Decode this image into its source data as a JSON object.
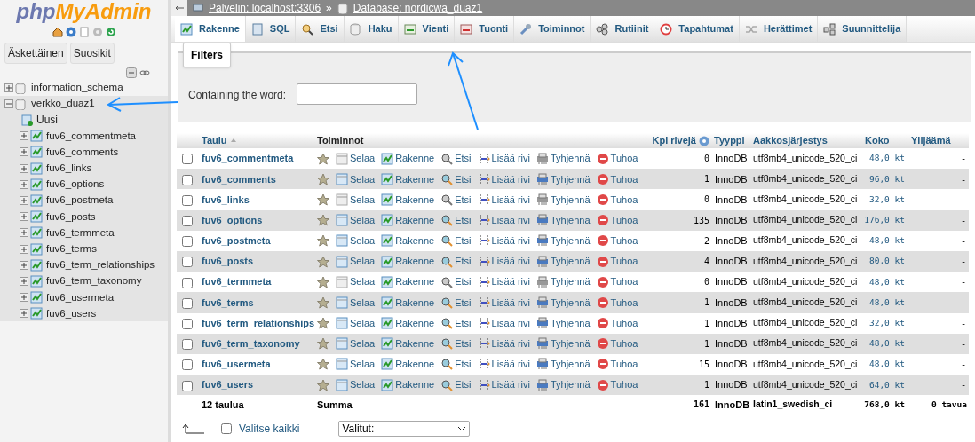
{
  "sidebar": {
    "logo": [
      "php",
      "MyAdmin"
    ],
    "tabs": [
      {
        "label": "Äskettäinen"
      },
      {
        "label": "Suosikit"
      }
    ],
    "tree": [
      {
        "label": "information_schema",
        "expanded": false,
        "selected": false
      },
      {
        "label": "verkko_duaz1",
        "expanded": true,
        "selected": true,
        "children": [
          {
            "label": "Uusi",
            "kind": "new"
          },
          {
            "label": "fuv6_commentmeta",
            "kind": "table"
          },
          {
            "label": "fuv6_comments",
            "kind": "table"
          },
          {
            "label": "fuv6_links",
            "kind": "table"
          },
          {
            "label": "fuv6_options",
            "kind": "table"
          },
          {
            "label": "fuv6_postmeta",
            "kind": "table"
          },
          {
            "label": "fuv6_posts",
            "kind": "table"
          },
          {
            "label": "fuv6_termmeta",
            "kind": "table"
          },
          {
            "label": "fuv6_terms",
            "kind": "table"
          },
          {
            "label": "fuv6_term_relationships",
            "kind": "table"
          },
          {
            "label": "fuv6_term_taxonomy",
            "kind": "table"
          },
          {
            "label": "fuv6_usermeta",
            "kind": "table"
          },
          {
            "label": "fuv6_users",
            "kind": "table"
          }
        ]
      }
    ]
  },
  "breadcrumb": [
    "Palvelin: localhost:3306",
    "»",
    "Database: nordicwa_duaz1"
  ],
  "tabs": [
    {
      "label": "Rakenne",
      "kind": "structure",
      "selected": true
    },
    {
      "label": "SQL",
      "kind": "sql",
      "selected": false
    },
    {
      "label": "Etsi",
      "kind": "search",
      "selected": false
    },
    {
      "label": "Haku",
      "kind": "query",
      "selected": false
    },
    {
      "label": "Vienti",
      "kind": "export",
      "selected": false
    },
    {
      "label": "Tuonti",
      "kind": "import",
      "selected": false
    },
    {
      "label": "Toiminnot",
      "kind": "operations",
      "selected": false
    },
    {
      "label": "Rutiinit",
      "kind": "routines",
      "selected": false
    },
    {
      "label": "Tapahtumat",
      "kind": "events",
      "selected": false
    },
    {
      "label": "Herättimet",
      "kind": "triggers",
      "selected": false
    },
    {
      "label": "Suunnittelija",
      "kind": "designer",
      "selected": false
    }
  ],
  "filters": {
    "legend": "Filters",
    "label": "Containing the word:"
  },
  "table": {
    "columns": [
      "Taulu",
      "Toiminnot",
      "Kpl rivejä",
      "Tyyppi",
      "Aakkosjärjestys",
      "Koko",
      "Ylijäämä"
    ],
    "rows": [
      {
        "name": "fuv6_commentmeta",
        "checked": false,
        "empty": true,
        "actions": [
          "Selaa",
          "Rakenne",
          "Etsi",
          "Lisää rivi",
          "Tyhjennä",
          "Tuhoa"
        ],
        "rows": "0",
        "type": "InnoDB",
        "collation": "utf8mb4_unicode_520_ci",
        "size": "48,0 kt",
        "overhead": "-"
      },
      {
        "name": "fuv6_comments",
        "checked": false,
        "empty": false,
        "actions": [
          "Selaa",
          "Rakenne",
          "Etsi",
          "Lisää rivi",
          "Tyhjennä",
          "Tuhoa"
        ],
        "rows": "1",
        "type": "InnoDB",
        "collation": "utf8mb4_unicode_520_ci",
        "size": "96,0 kt",
        "overhead": "-"
      },
      {
        "name": "fuv6_links",
        "checked": false,
        "empty": true,
        "actions": [
          "Selaa",
          "Rakenne",
          "Etsi",
          "Lisää rivi",
          "Tyhjennä",
          "Tuhoa"
        ],
        "rows": "0",
        "type": "InnoDB",
        "collation": "utf8mb4_unicode_520_ci",
        "size": "32,0 kt",
        "overhead": "-"
      },
      {
        "name": "fuv6_options",
        "checked": false,
        "empty": false,
        "actions": [
          "Selaa",
          "Rakenne",
          "Etsi",
          "Lisää rivi",
          "Tyhjennä",
          "Tuhoa"
        ],
        "rows": "135",
        "type": "InnoDB",
        "collation": "utf8mb4_unicode_520_ci",
        "size": "176,0 kt",
        "overhead": "-"
      },
      {
        "name": "fuv6_postmeta",
        "checked": false,
        "empty": false,
        "actions": [
          "Selaa",
          "Rakenne",
          "Etsi",
          "Lisää rivi",
          "Tyhjennä",
          "Tuhoa"
        ],
        "rows": "2",
        "type": "InnoDB",
        "collation": "utf8mb4_unicode_520_ci",
        "size": "48,0 kt",
        "overhead": "-"
      },
      {
        "name": "fuv6_posts",
        "checked": false,
        "empty": false,
        "actions": [
          "Selaa",
          "Rakenne",
          "Etsi",
          "Lisää rivi",
          "Tyhjennä",
          "Tuhoa"
        ],
        "rows": "4",
        "type": "InnoDB",
        "collation": "utf8mb4_unicode_520_ci",
        "size": "80,0 kt",
        "overhead": "-"
      },
      {
        "name": "fuv6_termmeta",
        "checked": false,
        "empty": true,
        "actions": [
          "Selaa",
          "Rakenne",
          "Etsi",
          "Lisää rivi",
          "Tyhjennä",
          "Tuhoa"
        ],
        "rows": "0",
        "type": "InnoDB",
        "collation": "utf8mb4_unicode_520_ci",
        "size": "48,0 kt",
        "overhead": "-"
      },
      {
        "name": "fuv6_terms",
        "checked": false,
        "empty": false,
        "actions": [
          "Selaa",
          "Rakenne",
          "Etsi",
          "Lisää rivi",
          "Tyhjennä",
          "Tuhoa"
        ],
        "rows": "1",
        "type": "InnoDB",
        "collation": "utf8mb4_unicode_520_ci",
        "size": "48,0 kt",
        "overhead": "-"
      },
      {
        "name": "fuv6_term_relationships",
        "checked": false,
        "empty": false,
        "actions": [
          "Selaa",
          "Rakenne",
          "Etsi",
          "Lisää rivi",
          "Tyhjennä",
          "Tuhoa"
        ],
        "rows": "1",
        "type": "InnoDB",
        "collation": "utf8mb4_unicode_520_ci",
        "size": "32,0 kt",
        "overhead": "-"
      },
      {
        "name": "fuv6_term_taxonomy",
        "checked": false,
        "empty": false,
        "actions": [
          "Selaa",
          "Rakenne",
          "Etsi",
          "Lisää rivi",
          "Tyhjennä",
          "Tuhoa"
        ],
        "rows": "1",
        "type": "InnoDB",
        "collation": "utf8mb4_unicode_520_ci",
        "size": "48,0 kt",
        "overhead": "-"
      },
      {
        "name": "fuv6_usermeta",
        "checked": false,
        "empty": false,
        "actions": [
          "Selaa",
          "Rakenne",
          "Etsi",
          "Lisää rivi",
          "Tyhjennä",
          "Tuhoa"
        ],
        "rows": "15",
        "type": "InnoDB",
        "collation": "utf8mb4_unicode_520_ci",
        "size": "48,0 kt",
        "overhead": "-"
      },
      {
        "name": "fuv6_users",
        "checked": false,
        "empty": false,
        "actions": [
          "Selaa",
          "Rakenne",
          "Etsi",
          "Lisää rivi",
          "Tyhjennä",
          "Tuhoa"
        ],
        "rows": "1",
        "type": "InnoDB",
        "collation": "utf8mb4_unicode_520_ci",
        "size": "64,0 kt",
        "overhead": "-"
      }
    ],
    "summary": {
      "count": "12 taulua",
      "label": "Summa",
      "rows": "161",
      "type": "InnoDB",
      "collation": "latin1_swedish_ci",
      "size": "768,0 kt",
      "overhead": "0 tavua"
    }
  },
  "footer": {
    "select_all": "Valitse kaikki",
    "checked": false,
    "dropdown": "Valitut:"
  }
}
